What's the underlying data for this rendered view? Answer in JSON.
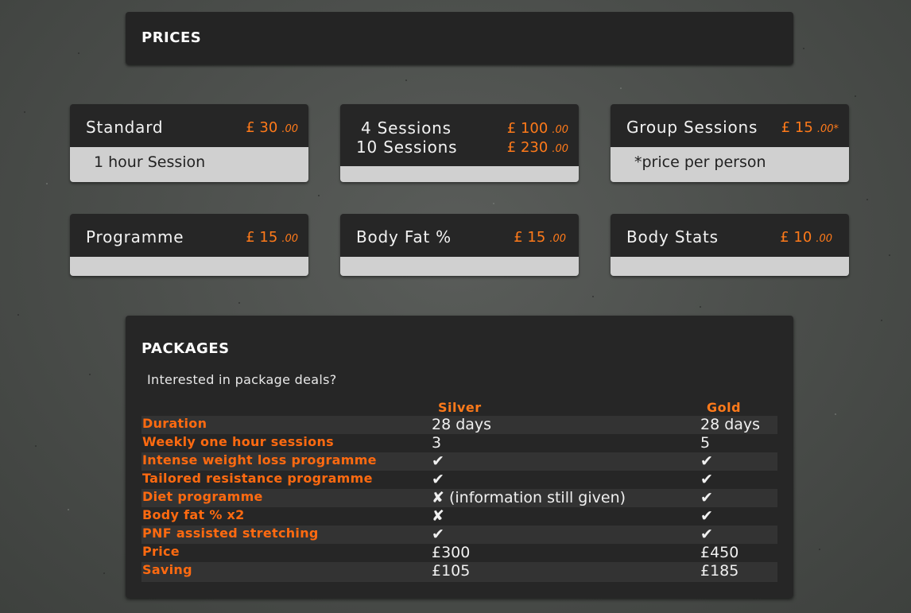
{
  "prices": {
    "heading": "PRICES",
    "cards": [
      {
        "name": "Standard",
        "currency": "£",
        "pounds": "30",
        "pence": ".00",
        "note": "1 hour Session"
      },
      {
        "name_line1": "4 Sessions",
        "name_line2": "10 Sessions",
        "currency": "£",
        "pounds1": "100",
        "pence1": ".00",
        "pounds2": "230",
        "pence2": ".00"
      },
      {
        "name": "Group Sessions",
        "currency": "£",
        "pounds": "15",
        "pence": ".00*",
        "note": "*price per person"
      },
      {
        "name": "Programme",
        "currency": "£",
        "pounds": "15",
        "pence": ".00"
      },
      {
        "name": "Body Fat %",
        "currency": "£",
        "pounds": "15",
        "pence": ".00"
      },
      {
        "name": "Body Stats",
        "currency": "£",
        "pounds": "10",
        "pence": ".00"
      }
    ]
  },
  "packages": {
    "heading": "PACKAGES",
    "intro": "Interested in package deals?",
    "columns": [
      "Silver",
      "Gold"
    ],
    "rows": [
      {
        "label": "Duration",
        "silver": "28 days",
        "gold": "28 days"
      },
      {
        "label": "Weekly one hour sessions",
        "silver": "3",
        "gold": "5"
      },
      {
        "label": "Intense weight loss programme",
        "silver": "✔",
        "gold": "✔"
      },
      {
        "label": "Tailored resistance programme",
        "silver": "✔",
        "gold": "✔"
      },
      {
        "label": "Diet programme",
        "silver": "✘ (information still given)",
        "gold": "✔"
      },
      {
        "label": "Body fat % x2",
        "silver": "✘",
        "gold": "✔"
      },
      {
        "label": "PNF assisted stretching",
        "silver": "✔",
        "gold": "✔"
      },
      {
        "label": "Price",
        "silver": "£300",
        "gold": "£450"
      },
      {
        "label": "Saving",
        "silver": "£105",
        "gold": "£185"
      }
    ]
  },
  "colors": {
    "accent": "#ff7a1a",
    "panel": "#262626",
    "card_bottom": "#d0d0d0"
  }
}
